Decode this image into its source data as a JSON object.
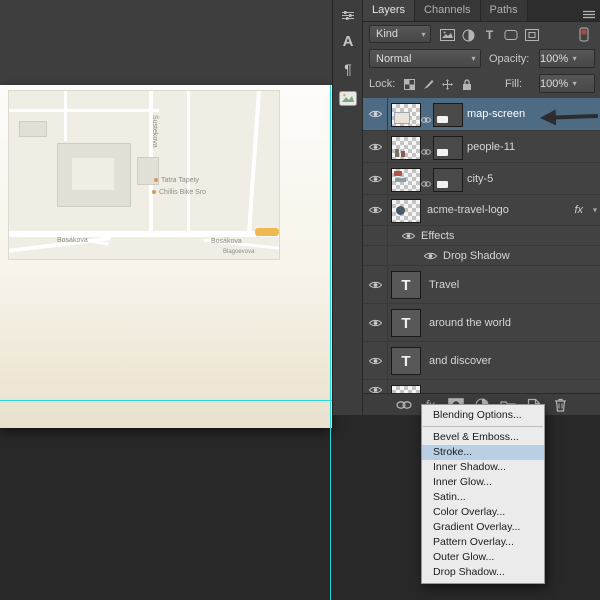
{
  "dock": {
    "character_glyph": "A",
    "paragraph_glyph": "¶"
  },
  "tabs": [
    "Layers",
    "Channels",
    "Paths"
  ],
  "filter_row": {
    "kind": "Kind"
  },
  "blend_row": {
    "mode": "Normal",
    "opacity_label": "Opacity:",
    "opacity_value": "100%"
  },
  "lock_row": {
    "label": "Lock:",
    "fill_label": "Fill:",
    "fill_value": "100%"
  },
  "layers": [
    {
      "name": "map-screen",
      "selected": true
    },
    {
      "name": "people-11"
    },
    {
      "name": "city-5"
    },
    {
      "name": "acme-travel-logo",
      "has_fx": true
    },
    {
      "name": "Effects"
    },
    {
      "name": "Drop Shadow"
    },
    {
      "name": "Travel"
    },
    {
      "name": "around the world"
    },
    {
      "name": "and discover"
    }
  ],
  "badges": {
    "fx": "fx",
    "type_thumb": "T",
    "chevron": "▾"
  },
  "menu": {
    "items": [
      "Blending Options...",
      "Bevel & Emboss...",
      "Stroke...",
      "Inner Shadow...",
      "Inner Glow...",
      "Satin...",
      "Color Overlay...",
      "Gradient Overlay...",
      "Pattern Overlay...",
      "Outer Glow...",
      "Drop Shadow..."
    ],
    "highlighted": "Stroke..."
  },
  "map": {
    "street_vertical": "Šustekova",
    "street_main_left": "Bosákova",
    "street_main_right": "Bosákova",
    "street_small": "Blagoevova",
    "poi_1": "Tatra Tapety",
    "poi_2": "Chillis Bike Sro"
  },
  "colors": {
    "guide": "#26d9d9",
    "selection": "#4e6b84",
    "menu_highlight": "#b9cfe4"
  }
}
